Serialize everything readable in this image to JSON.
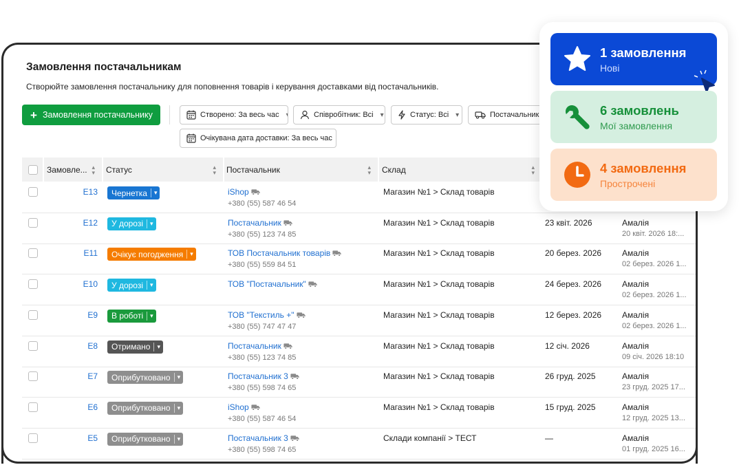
{
  "page": {
    "title": "Замовлення постачальникам",
    "description": "Створюйте замовлення постачальнику для поповнення товарів і керування доставками від постачальників."
  },
  "toolbar": {
    "create_label": "Замовлення постачальнику",
    "filters": {
      "created": "Створено: За весь час",
      "employee": "Співробітник: Всі",
      "status": "Статус: Всі",
      "supplier": "Постачальник: Всі",
      "expected": "Очікувана дата доставки: За весь час"
    }
  },
  "table": {
    "headers": {
      "order": "Замовле...",
      "status": "Статус",
      "supplier": "Постачальник",
      "warehouse": "Склад"
    },
    "rows": [
      {
        "num": "E13",
        "status": "Чернетка",
        "status_color": "#1976d2",
        "supplier": "iShop",
        "phone": "+380 (55) 587 46 54",
        "warehouse": "Магазин №1 > Склад товарів",
        "date": "",
        "user": "",
        "updated": ""
      },
      {
        "num": "E12",
        "status": "У дорозі",
        "status_color": "#1fb8e0",
        "supplier": "Постачальник",
        "phone": "+380 (55) 123 74 85",
        "warehouse": "Магазин №1 > Склад товарів",
        "date": "23 квіт. 2026",
        "user": "Амалія",
        "updated": "20 квіт. 2026 18:..."
      },
      {
        "num": "E11",
        "status": "Очікує погодження",
        "status_color": "#f57c00",
        "supplier": "ТОВ Постачальник товарів",
        "phone": "+380 (55) 559 84 51",
        "warehouse": "Магазин №1 > Склад товарів",
        "date": "20 берез. 2026",
        "user": "Амалія",
        "updated": "02 берез. 2026 1..."
      },
      {
        "num": "E10",
        "status": "У дорозі",
        "status_color": "#1fb8e0",
        "supplier": "ТОВ \"Постачальник\"",
        "phone": "",
        "warehouse": "Магазин №1 > Склад товарів",
        "date": "24 берез. 2026",
        "user": "Амалія",
        "updated": "02 берез. 2026 1..."
      },
      {
        "num": "E9",
        "status": "В роботі",
        "status_color": "#1a9a3c",
        "supplier": "ТОВ \"Текстиль +\"",
        "phone": "+380 (55) 747 47 47",
        "warehouse": "Магазин №1 > Склад товарів",
        "date": "12 берез. 2026",
        "user": "Амалія",
        "updated": "02 берез. 2026 1..."
      },
      {
        "num": "E8",
        "status": "Отримано",
        "status_color": "#555555",
        "supplier": "Постачальник",
        "phone": "+380 (55) 123 74 85",
        "warehouse": "Магазин №1 > Склад товарів",
        "date": "12 січ. 2026",
        "user": "Амалія",
        "updated": "09 січ. 2026 18:10"
      },
      {
        "num": "E7",
        "status": "Оприбутковано",
        "status_color": "#8e8e8e",
        "supplier": "Постачальник 3",
        "phone": "+380 (55) 598 74 65",
        "warehouse": "Магазин №1 > Склад товарів",
        "date": "26 груд. 2025",
        "user": "Амалія",
        "updated": "23 груд. 2025 17..."
      },
      {
        "num": "E6",
        "status": "Оприбутковано",
        "status_color": "#8e8e8e",
        "supplier": "iShop",
        "phone": "+380 (55) 587 46 54",
        "warehouse": "Магазин №1 > Склад товарів",
        "date": "15 груд. 2025",
        "user": "Амалія",
        "updated": "12 груд. 2025 13..."
      },
      {
        "num": "E5",
        "status": "Оприбутковано",
        "status_color": "#8e8e8e",
        "supplier": "Постачальник 3",
        "phone": "+380 (55) 598 74 65",
        "warehouse": "Склади компанії > ТЕСТ",
        "date": "—",
        "user": "Амалія",
        "updated": "01 груд. 2025 16..."
      }
    ]
  },
  "summary": {
    "new": {
      "title": "1 замовлення",
      "subtitle": "Нові",
      "icon": "star-icon",
      "bg": "#0b49d6"
    },
    "mine": {
      "title": "6 замовлень",
      "subtitle": "Мої замовлення",
      "icon": "wrench-icon",
      "bg": "#d5efe0"
    },
    "overdue": {
      "title": "4 замовлення",
      "subtitle": "Прострочені",
      "icon": "clock-icon",
      "bg": "#fde1cc"
    }
  }
}
